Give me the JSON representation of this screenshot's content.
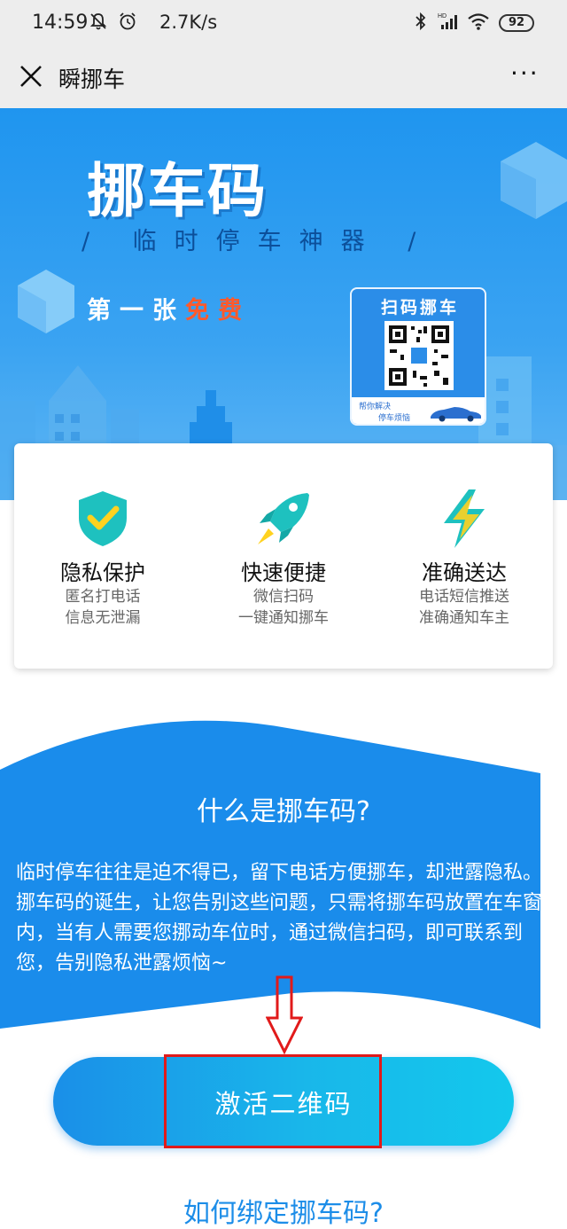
{
  "status_bar": {
    "time": "14:59",
    "net_speed": "2.7K/s",
    "battery": "92"
  },
  "nav": {
    "title": "瞬挪车",
    "more": "···"
  },
  "banner": {
    "title": "挪车码",
    "subtitle": "/ 临时停车神器 /",
    "free_prefix": "第一张",
    "free_highlight": "免费",
    "qr_card": {
      "title": "扫码挪车",
      "foot_line1": "帮你解决",
      "foot_line2": "停车烦恼"
    }
  },
  "features": [
    {
      "icon": "shield-check-icon",
      "title": "隐私保护",
      "line1": "匿名打电话",
      "line2": "信息无泄漏"
    },
    {
      "icon": "rocket-icon",
      "title": "快速便捷",
      "line1": "微信扫码",
      "line2": "一键通知挪车"
    },
    {
      "icon": "lightning-icon",
      "title": "准确送达",
      "line1": "电话短信推送",
      "line2": "准确通知车主"
    }
  ],
  "about": {
    "title": "什么是挪车码?",
    "text": "临时停车往往是迫不得已，留下电话方便挪车，却泄露隐私。挪车码的诞生，让您告别这些问题，只需将挪车码放置在车窗内，当有人需要您挪动车位时，通过微信扫码，即可联系到您，告别隐私泄露烦恼~"
  },
  "activate_button": {
    "label": "激活二维码"
  },
  "bind_link": {
    "label": "如何绑定挪车码?"
  },
  "colors": {
    "primary": "#1c8de8",
    "banner": "#1f95ef",
    "highlight": "#e11a1a",
    "free": "#ff5a2b"
  }
}
